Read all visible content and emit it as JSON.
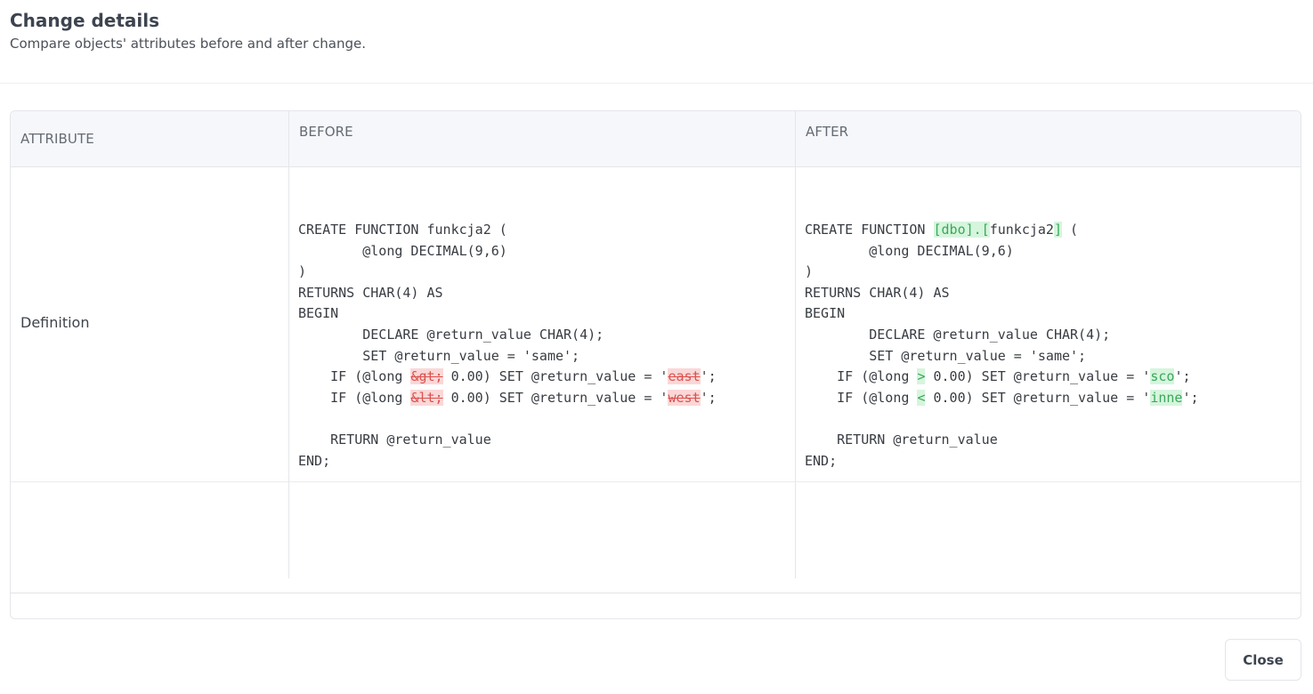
{
  "dialog": {
    "title": "Change details",
    "subtitle": "Compare objects' attributes before and after change.",
    "close_label": "Close"
  },
  "table": {
    "columns": [
      "ATTRIBUTE",
      "BEFORE",
      "AFTER"
    ],
    "rows": [
      {
        "attribute": "Definition"
      },
      {
        "attribute": ""
      }
    ]
  },
  "before": {
    "l1": "CREATE FUNCTION funkcja2 (",
    "l2_8": "        @long DECIMAL(9,6)\n)\nRETURNS CHAR(4) AS\nBEGIN\n        DECLARE @return_value CHAR(4);\n        SET @return_value = 'same';\n    IF (@long ",
    "gt": "&gt;",
    "mid1": " 0.00) SET @return_value = '",
    "east": "east",
    "end1": "';\n    IF (@long ",
    "lt": "&lt;",
    "mid2": " 0.00) SET @return_value = '",
    "west": "west",
    "tail": "';\n\n    RETURN @return_value\nEND;"
  },
  "after": {
    "l1a": "CREATE FUNCTION ",
    "dbo": "[dbo].[",
    "fname": "funkcja2",
    "rb": "]",
    "l1b": " (",
    "l2_8": "\n        @long DECIMAL(9,6)\n)\nRETURNS CHAR(4) AS\nBEGIN\n        DECLARE @return_value CHAR(4);\n        SET @return_value = 'same';\n    IF (@long ",
    "gt": ">",
    "mid1": " 0.00) SET @return_value = '",
    "sco": "sco",
    "end1": "';\n    IF (@long ",
    "lt": "<",
    "mid2": " 0.00) SET @return_value = '",
    "inne": "inne",
    "tail": "';\n\n    RETURN @return_value\nEND;"
  },
  "colors": {
    "deleted_bg": "#fbd7d7",
    "deleted_text": "#d9534f",
    "inserted_bg": "#d6f5dd",
    "inserted_text": "#39a85a",
    "header_bg": "#f6f7fb"
  }
}
